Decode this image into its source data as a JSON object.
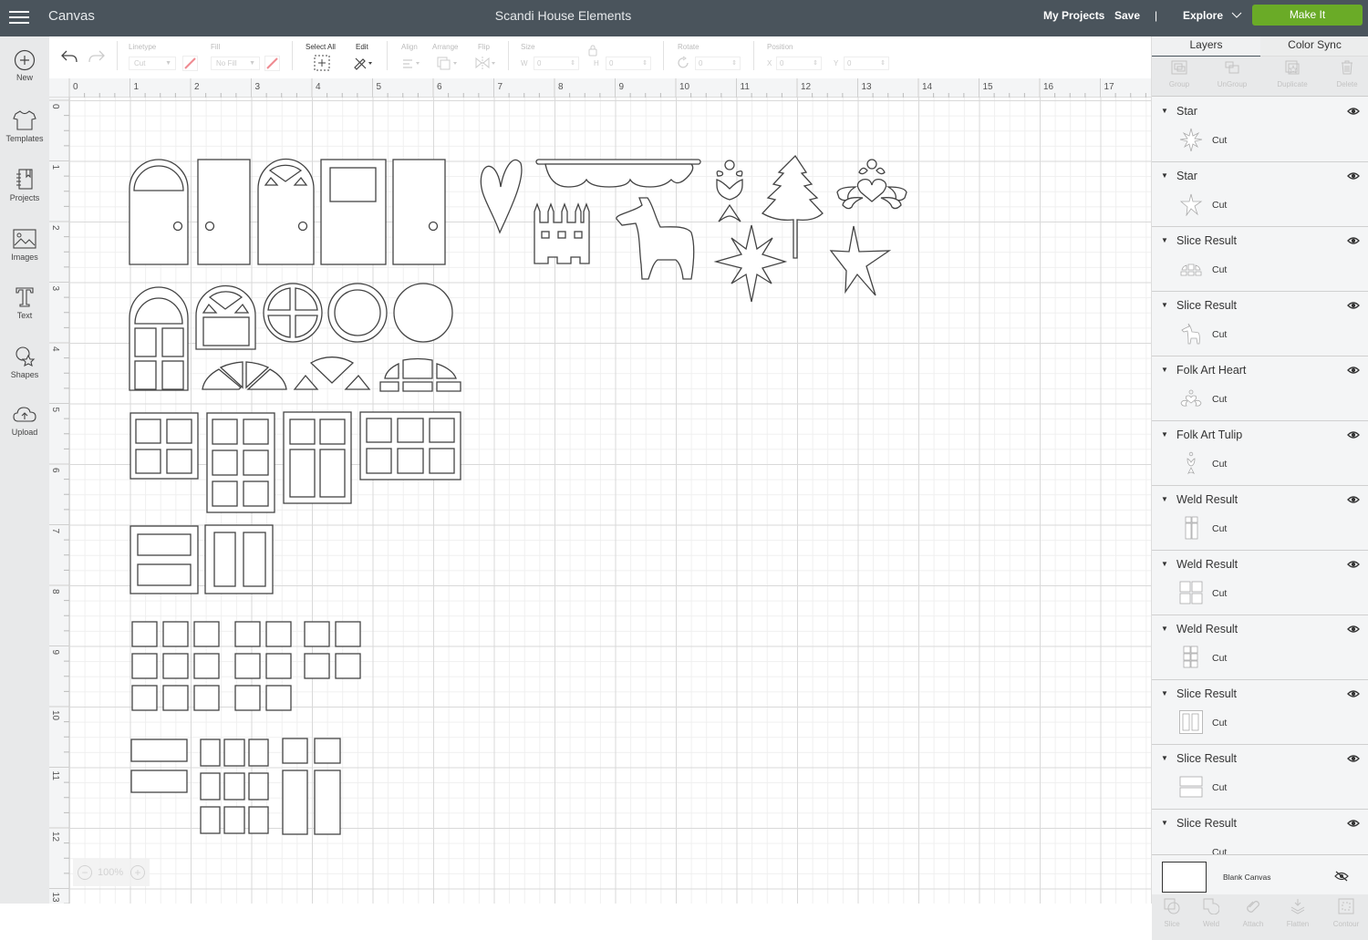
{
  "topbar": {
    "app_name": "Canvas",
    "title": "Scandi House Elements",
    "my_projects": "My Projects",
    "save": "Save",
    "separator": "|",
    "explore": "Explore",
    "make_it": "Make It",
    "make_it_color": "#6aab27"
  },
  "sidebar": {
    "items": [
      {
        "label": "New",
        "icon": "plus-circle-icon"
      },
      {
        "label": "Templates",
        "icon": "tshirt-icon"
      },
      {
        "label": "Projects",
        "icon": "notebook-icon"
      },
      {
        "label": "Images",
        "icon": "image-icon"
      },
      {
        "label": "Text",
        "icon": "text-t-icon"
      },
      {
        "label": "Shapes",
        "icon": "shapes-icon"
      },
      {
        "label": "Upload",
        "icon": "cloud-upload-icon"
      }
    ]
  },
  "toolbar": {
    "linetype_label": "Linetype",
    "linetype_value": "Cut",
    "fill_label": "Fill",
    "fill_value": "No Fill",
    "select_all_label": "Select All",
    "edit_label": "Edit",
    "align_label": "Align",
    "arrange_label": "Arrange",
    "flip_label": "Flip",
    "size_label": "Size",
    "w_label": "W",
    "w_value": "0",
    "h_label": "H",
    "h_value": "0",
    "rotate_label": "Rotate",
    "rotate_value": "0",
    "position_label": "Position",
    "x_label": "X",
    "x_value": "0",
    "y_label": "Y",
    "y_value": "0"
  },
  "rulers": {
    "horizontal": [
      "0",
      "1",
      "2",
      "3",
      "4",
      "5",
      "6",
      "7",
      "8",
      "9",
      "10",
      "11",
      "12",
      "13",
      "14",
      "15",
      "16",
      "17"
    ],
    "vertical": [
      "0",
      "1",
      "2",
      "3",
      "4",
      "5",
      "6",
      "7",
      "8",
      "9",
      "10",
      "11",
      "12",
      "13"
    ]
  },
  "zoom": {
    "minus": "−",
    "value": "100%",
    "plus": "+"
  },
  "panel": {
    "tabs": [
      {
        "label": "Layers",
        "active": true
      },
      {
        "label": "Color Sync",
        "active": false
      }
    ],
    "tools": [
      "Group",
      "UnGroup",
      "Duplicate",
      "Delete"
    ],
    "layers": [
      {
        "name": "Star",
        "type": "Cut",
        "thumb": "star8"
      },
      {
        "name": "Star",
        "type": "Cut",
        "thumb": "star5"
      },
      {
        "name": "Slice Result",
        "type": "Cut",
        "thumb": "arch"
      },
      {
        "name": "Slice Result",
        "type": "Cut",
        "thumb": "horse"
      },
      {
        "name": "Folk Art Heart",
        "type": "Cut",
        "thumb": "heart"
      },
      {
        "name": "Folk Art Tulip",
        "type": "Cut",
        "thumb": "tulip"
      },
      {
        "name": "Weld Result",
        "type": "Cut",
        "thumb": "win-tall"
      },
      {
        "name": "Weld Result",
        "type": "Cut",
        "thumb": "win-4"
      },
      {
        "name": "Weld Result",
        "type": "Cut",
        "thumb": "win-6"
      },
      {
        "name": "Slice Result",
        "type": "Cut",
        "thumb": "win-v"
      },
      {
        "name": "Slice Result",
        "type": "Cut",
        "thumb": "win-h"
      },
      {
        "name": "Slice Result",
        "type": "Cut",
        "thumb": "none"
      }
    ],
    "blank_canvas": "Blank Canvas",
    "bottom_tools": [
      "Slice",
      "Weld",
      "Attach",
      "Flatten",
      "Contour"
    ]
  }
}
